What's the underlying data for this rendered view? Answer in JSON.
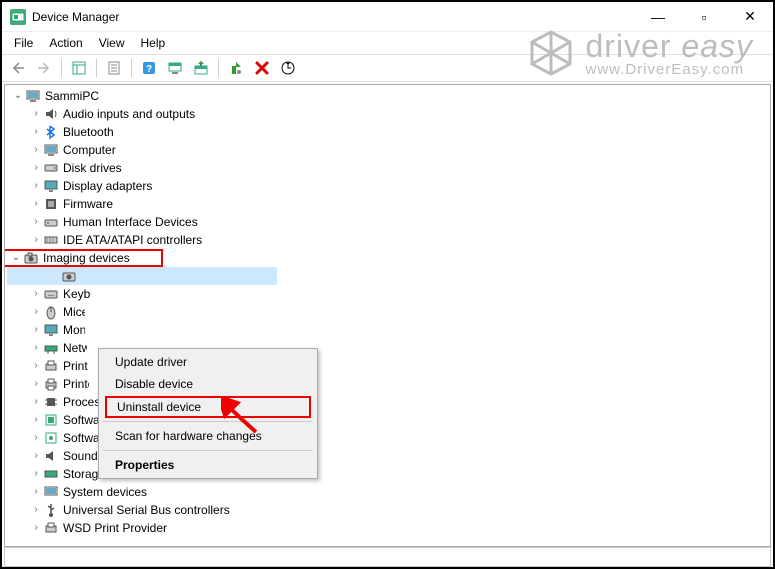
{
  "titlebar": {
    "title": "Device Manager",
    "minimize": "—",
    "maximize": "▫",
    "close": "✕"
  },
  "menubar": {
    "file": "File",
    "action": "Action",
    "view": "View",
    "help": "Help"
  },
  "tree": {
    "root": "SammiPC",
    "items": [
      "Audio inputs and outputs",
      "Bluetooth",
      "Computer",
      "Disk drives",
      "Display adapters",
      "Firmware",
      "Human Interface Devices",
      "IDE ATA/ATAPI controllers",
      "Imaging devices",
      "Keyboards",
      "Mice and other pointing devices",
      "Monitors",
      "Network adapters",
      "Print queues",
      "Printers",
      "Processors",
      "Software components",
      "Software devices",
      "Sound, video and game controllers",
      "Storage controllers",
      "System devices",
      "Universal Serial Bus controllers",
      "WSD Print Provider"
    ],
    "hidden_child": " "
  },
  "context_menu": {
    "update": "Update driver",
    "disable": "Disable device",
    "uninstall": "Uninstall device",
    "scan": "Scan for hardware changes",
    "properties": "Properties"
  },
  "watermark": {
    "line1a": "driver",
    "line1b": "easy",
    "line2": "www.DriverEasy.com"
  }
}
